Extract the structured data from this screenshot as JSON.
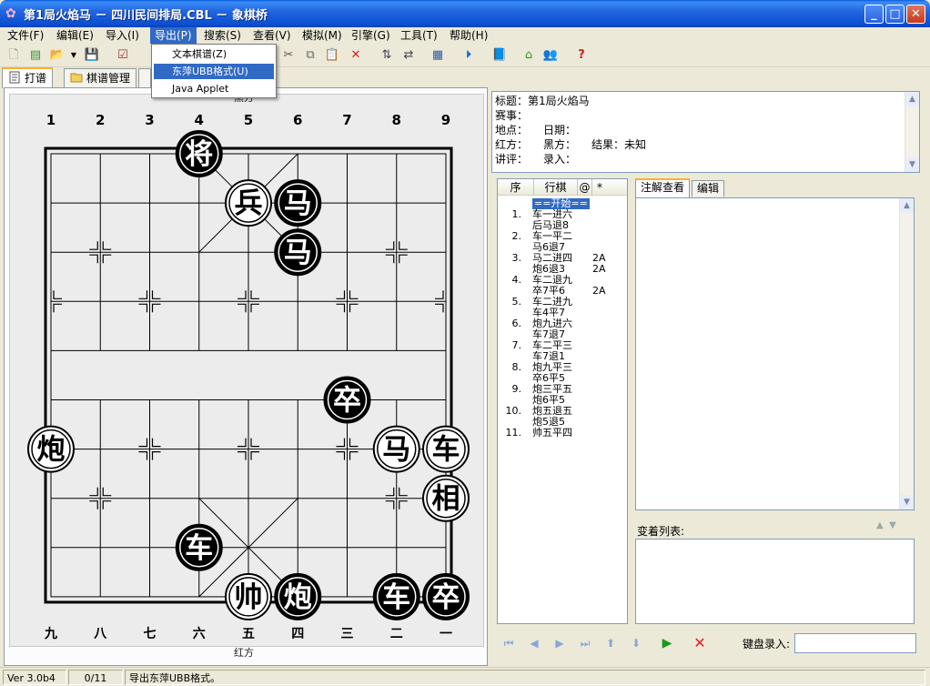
{
  "window": {
    "title": "第1局火焰马 － 四川民间排局.CBL － 象棋桥",
    "minimize": "_",
    "maximize": "□",
    "close": "✕"
  },
  "menu": [
    {
      "label": "文件(F)"
    },
    {
      "label": "编辑(E)"
    },
    {
      "label": "导入(I)"
    },
    {
      "label": "导出(P)"
    },
    {
      "label": "搜索(S)"
    },
    {
      "label": "查看(V)"
    },
    {
      "label": "模拟(M)"
    },
    {
      "label": "引擎(G)"
    },
    {
      "label": "工具(T)"
    },
    {
      "label": "帮助(H)"
    }
  ],
  "export_menu": [
    {
      "label": "文本棋谱(Z)"
    },
    {
      "label": "东萍UBB格式(U)"
    },
    {
      "label": "Java Applet"
    }
  ],
  "tabs": [
    {
      "label": "打谱"
    },
    {
      "label": "棋谱管理"
    }
  ],
  "board": {
    "top_label": "黑方",
    "bottom_label": "红方",
    "top_files": [
      "1",
      "2",
      "3",
      "4",
      "5",
      "6",
      "7",
      "8",
      "9"
    ],
    "bottom_files": [
      "九",
      "八",
      "七",
      "六",
      "五",
      "四",
      "三",
      "二",
      "一"
    ],
    "pieces": [
      {
        "ch": "将",
        "side": "black",
        "col": 3,
        "row": 0
      },
      {
        "ch": "兵",
        "side": "red",
        "col": 4,
        "row": 1
      },
      {
        "ch": "马",
        "side": "black",
        "col": 5,
        "row": 1
      },
      {
        "ch": "马",
        "side": "black",
        "col": 5,
        "row": 2
      },
      {
        "ch": "卒",
        "side": "black",
        "col": 6,
        "row": 5
      },
      {
        "ch": "炮",
        "side": "red",
        "col": 0,
        "row": 6
      },
      {
        "ch": "马",
        "side": "red",
        "col": 7,
        "row": 6
      },
      {
        "ch": "车",
        "side": "red",
        "col": 8,
        "row": 6
      },
      {
        "ch": "相",
        "side": "red",
        "col": 8,
        "row": 7
      },
      {
        "ch": "车",
        "side": "black",
        "col": 3,
        "row": 8
      },
      {
        "ch": "帅",
        "side": "red",
        "col": 4,
        "row": 9
      },
      {
        "ch": "炮",
        "side": "black",
        "col": 5,
        "row": 9
      },
      {
        "ch": "车",
        "side": "black",
        "col": 7,
        "row": 9
      },
      {
        "ch": "卒",
        "side": "black",
        "col": 8,
        "row": 9
      }
    ]
  },
  "info": {
    "title_label": "标题：",
    "title_value": "第1局火焰马",
    "event_label": "赛事：",
    "place_label": "地点：",
    "date_label": "日期：",
    "red_label": "红方：",
    "black_label": "黑方：",
    "result_label": "结果：",
    "result_value": "未知",
    "commentator_label": "讲评：",
    "recorder_label": "录入："
  },
  "moves": {
    "headers": [
      "序",
      "行棋",
      "@",
      "*"
    ],
    "start": "==开始==",
    "rows": [
      {
        "num": "1.",
        "mv": "车一进六",
        "mark": ""
      },
      {
        "num": "",
        "mv": "后马退8",
        "mark": ""
      },
      {
        "num": "2.",
        "mv": "车一平二",
        "mark": ""
      },
      {
        "num": "",
        "mv": "马6退7",
        "mark": ""
      },
      {
        "num": "3.",
        "mv": "马二进四",
        "mark": "2A"
      },
      {
        "num": "",
        "mv": "炮6退3",
        "mark": "2A"
      },
      {
        "num": "4.",
        "mv": "车二退九",
        "mark": ""
      },
      {
        "num": "",
        "mv": "卒7平6",
        "mark": "2A"
      },
      {
        "num": "5.",
        "mv": "车二进九",
        "mark": ""
      },
      {
        "num": "",
        "mv": "车4平7",
        "mark": ""
      },
      {
        "num": "6.",
        "mv": "炮九进六",
        "mark": ""
      },
      {
        "num": "",
        "mv": "车7退7",
        "mark": ""
      },
      {
        "num": "7.",
        "mv": "车二平三",
        "mark": ""
      },
      {
        "num": "",
        "mv": "车7退1",
        "mark": ""
      },
      {
        "num": "8.",
        "mv": "炮九平三",
        "mark": ""
      },
      {
        "num": "",
        "mv": "卒6平5",
        "mark": ""
      },
      {
        "num": "9.",
        "mv": "炮三平五",
        "mark": ""
      },
      {
        "num": "",
        "mv": "炮6平5",
        "mark": ""
      },
      {
        "num": "10.",
        "mv": "炮五退五",
        "mark": ""
      },
      {
        "num": "",
        "mv": "炮5退5",
        "mark": ""
      },
      {
        "num": "11.",
        "mv": "帅五平四",
        "mark": ""
      }
    ]
  },
  "comment_tabs": [
    {
      "label": "注解查看"
    },
    {
      "label": "编辑"
    }
  ],
  "variation_label": "变着列表:",
  "keyboard_label": "键盘录入:",
  "status": {
    "version": "Ver 3.0b4",
    "progress": "0/11",
    "message": "导出东萍UBB格式。"
  }
}
